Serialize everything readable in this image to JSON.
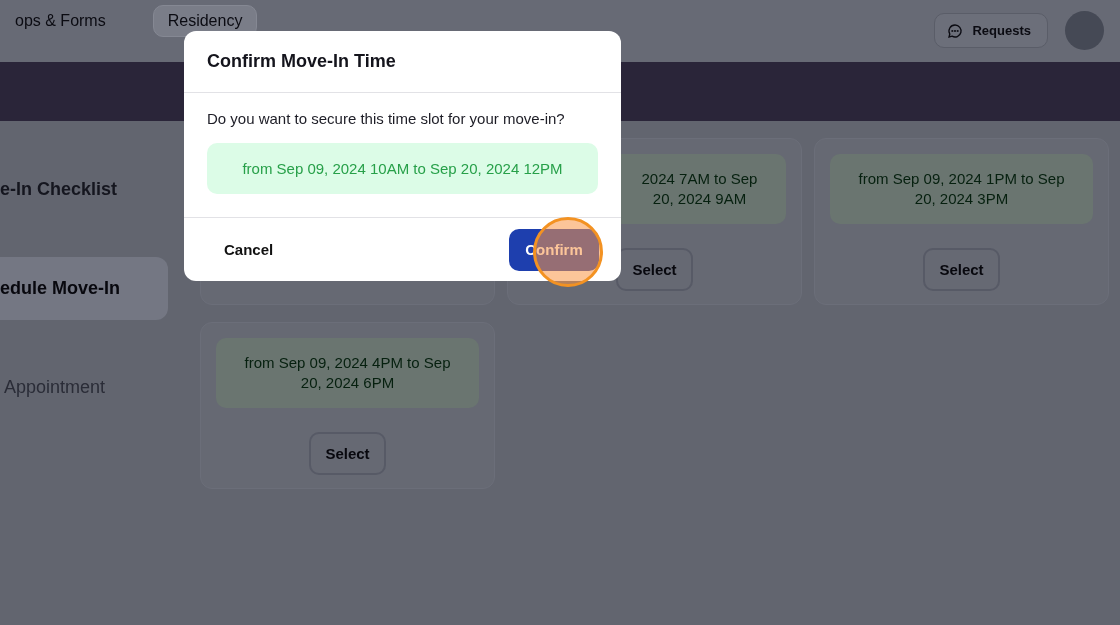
{
  "nav": {
    "tabs": [
      {
        "label": "ops & Forms",
        "selected": false
      },
      {
        "label": "Residency",
        "selected": true
      }
    ],
    "requests_button": "Requests"
  },
  "sidebar": {
    "items": [
      {
        "label": "e-In Checklist",
        "selected": false,
        "disabled": false
      },
      {
        "label": "edule Move-In",
        "selected": true,
        "disabled": false
      },
      {
        "label": "Appointment",
        "selected": false,
        "disabled": true
      }
    ]
  },
  "slots": [
    {
      "kind": "partial",
      "time": "2024 7AM to Sep 20, 2024 9AM",
      "button": "Select"
    },
    {
      "kind": "full",
      "time": "from Sep 09, 2024 1PM to Sep 20, 2024 3PM",
      "button": "Select"
    },
    {
      "kind": "full",
      "time": "from Sep 09, 2024 4PM to Sep 20, 2024 6PM",
      "button": "Select"
    }
  ],
  "dialog": {
    "title": "Confirm Move-In Time",
    "message": "Do you want to secure this time slot for your move-in?",
    "slot": "from Sep 09, 2024 10AM to Sep 20, 2024 12PM",
    "cancel": "Cancel",
    "confirm": "Confirm"
  }
}
